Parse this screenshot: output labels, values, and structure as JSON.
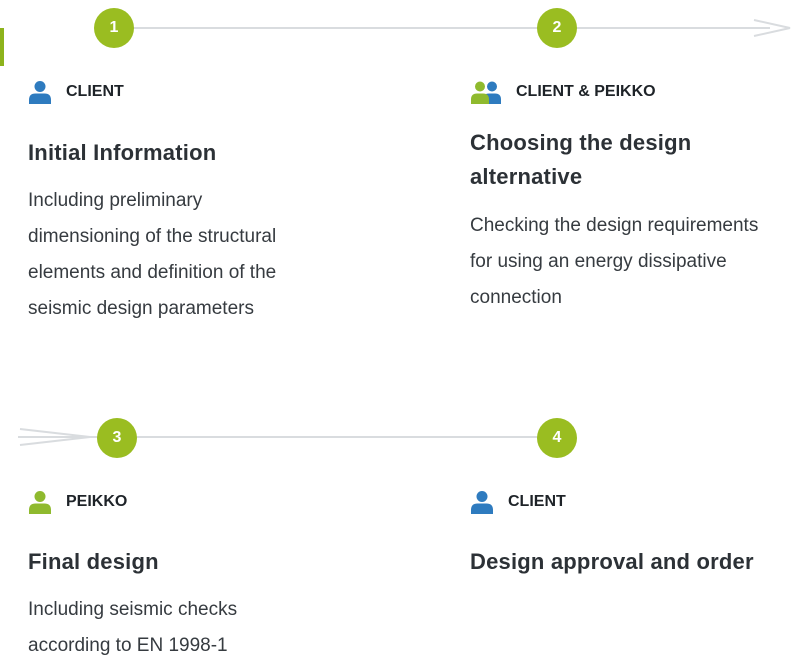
{
  "colors": {
    "accent_green": "#99b81f",
    "client_blue": "#2e7bbf",
    "peikko_green": "#8fba2e",
    "line_gray": "#d9dcdf"
  },
  "steps": [
    {
      "number": "1",
      "role": "CLIENT",
      "role_icon": "person-icon-blue",
      "title": "Initial Information",
      "description": "Including preliminary dimensioning of the structural elements and definition of the seismic design parameters"
    },
    {
      "number": "2",
      "role": "CLIENT & PEIKKO",
      "role_icon": "people-icon-green-blue",
      "title": "Choosing the design alternative",
      "description": "Checking the design requirements for using an energy dissipative connection"
    },
    {
      "number": "3",
      "role": "PEIKKO",
      "role_icon": "person-icon-green",
      "title": "Final design",
      "description": "Including seismic checks according to EN 1998-1"
    },
    {
      "number": "4",
      "role": "CLIENT",
      "role_icon": "person-icon-blue",
      "title": "Design approval and order",
      "description": ""
    }
  ]
}
